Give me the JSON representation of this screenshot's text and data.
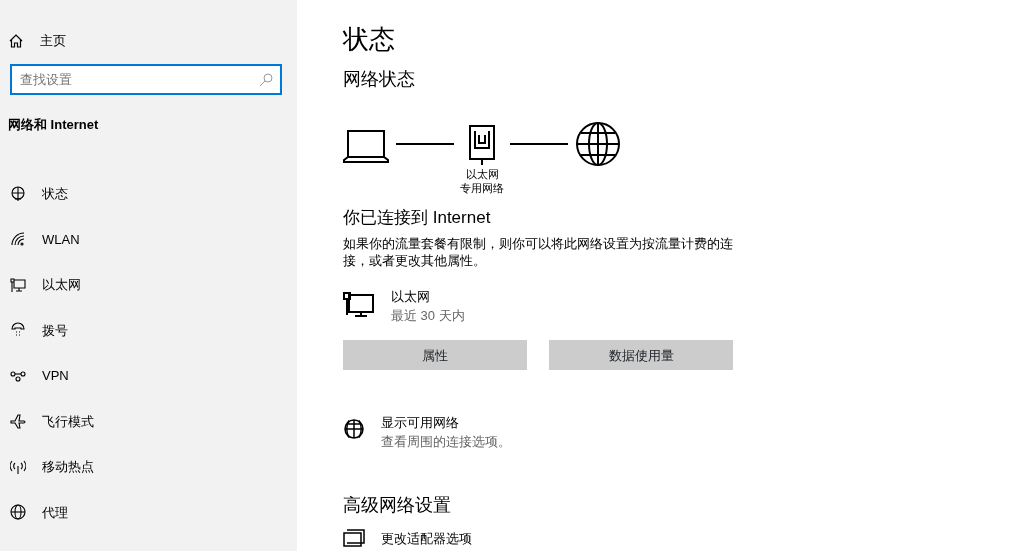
{
  "sidebar": {
    "home": "主页",
    "search": {
      "placeholder": "查找设置"
    },
    "section": "网络和 Internet",
    "items": [
      {
        "label": "状态",
        "kind": "status"
      },
      {
        "label": "WLAN",
        "kind": "wifi"
      },
      {
        "label": "以太网",
        "kind": "ethernet"
      },
      {
        "label": "拨号",
        "kind": "dialup"
      },
      {
        "label": "VPN",
        "kind": "vpn"
      },
      {
        "label": "飞行模式",
        "kind": "airplane"
      },
      {
        "label": "移动热点",
        "kind": "hotspot"
      },
      {
        "label": "代理",
        "kind": "globe"
      }
    ]
  },
  "main": {
    "title": "状态",
    "network_status": "网络状态",
    "diagram": {
      "adapter_label": "以太网",
      "network_label": "专用网络"
    },
    "connected": "你已连接到 Internet",
    "description": "如果你的流量套餐有限制，则你可以将此网络设置为按流量计费的连接，或者更改其他属性。",
    "connection": {
      "name": "以太网",
      "usage": "最近 30 天内"
    },
    "buttons": [
      "属性",
      "数据使用量"
    ],
    "show_networks": {
      "title": "显示可用网络",
      "subtitle": "查看周围的连接选项。"
    },
    "advanced": "高级网络设置",
    "advanced_items": [
      {
        "label": "更改适配器选项"
      }
    ]
  }
}
